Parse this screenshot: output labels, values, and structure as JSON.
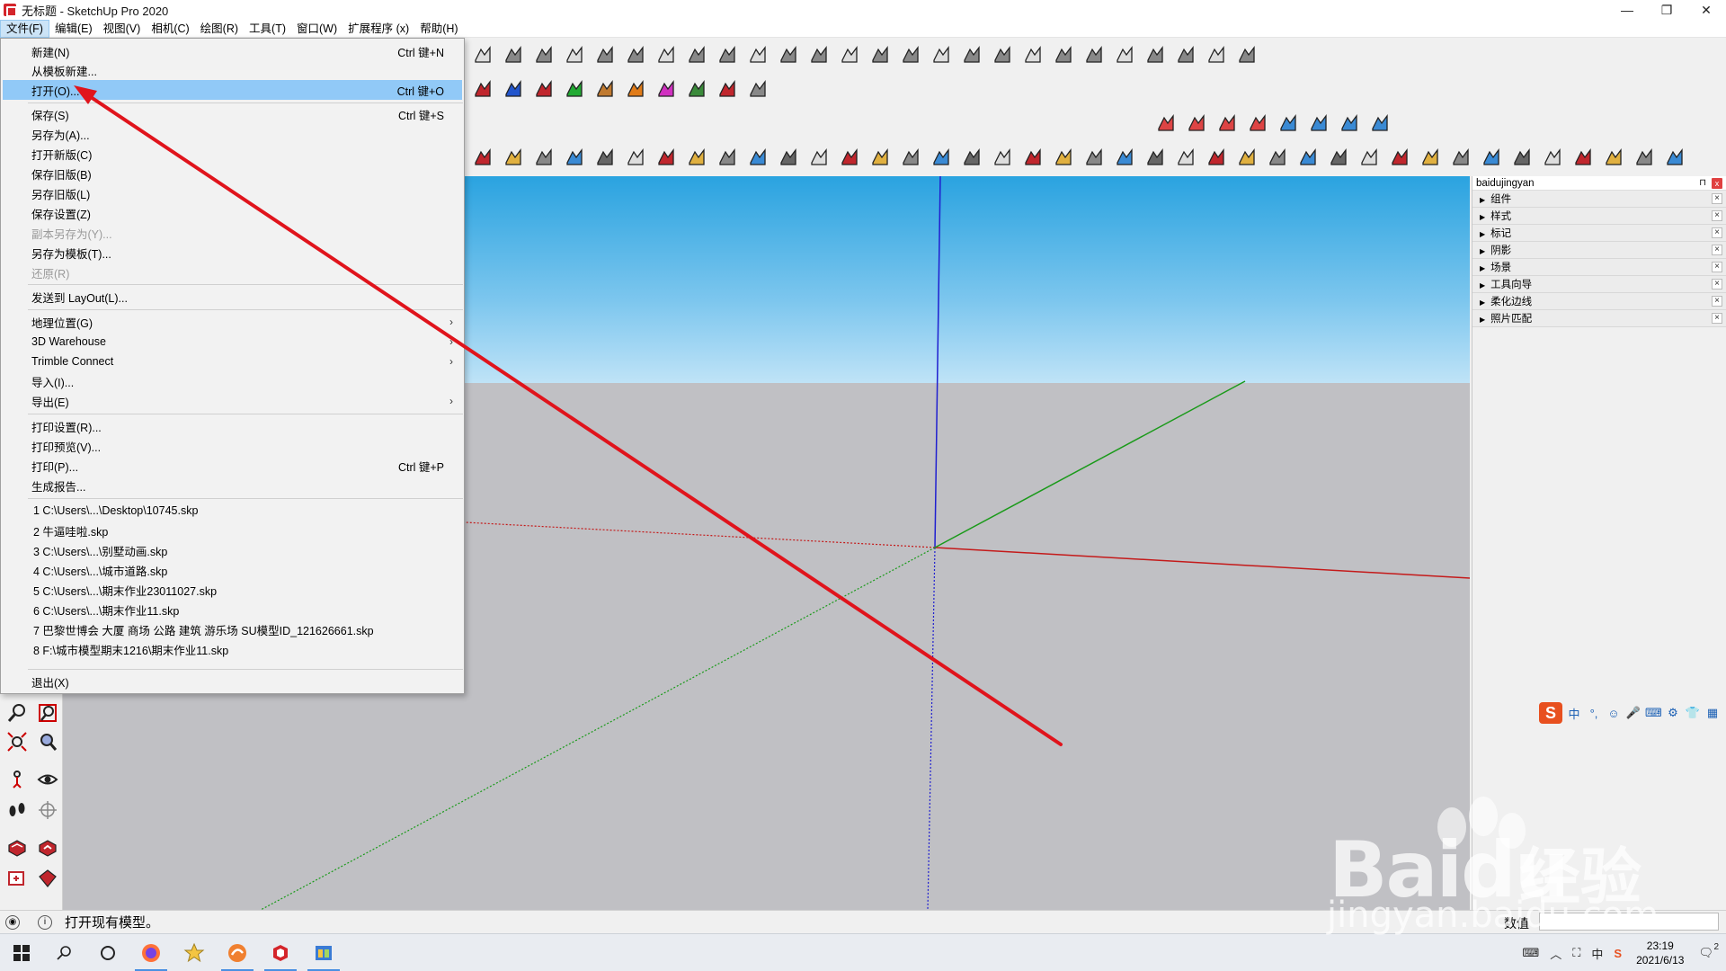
{
  "window": {
    "title": "无标题 - SketchUp Pro 2020",
    "minimize": "—",
    "restore": "❐",
    "close": "✕"
  },
  "menubar": [
    {
      "id": "file",
      "label": "文件(F)"
    },
    {
      "id": "edit",
      "label": "编辑(E)"
    },
    {
      "id": "view",
      "label": "视图(V)"
    },
    {
      "id": "camera",
      "label": "相机(C)"
    },
    {
      "id": "draw",
      "label": "绘图(R)"
    },
    {
      "id": "tools",
      "label": "工具(T)"
    },
    {
      "id": "window",
      "label": "窗口(W)"
    },
    {
      "id": "extensions",
      "label": "扩展程序 (x)"
    },
    {
      "id": "help",
      "label": "帮助(H)"
    }
  ],
  "file_menu": {
    "new": {
      "label": "新建(N)",
      "shortcut": "Ctrl 键+N"
    },
    "new_from_template": {
      "label": "从模板新建..."
    },
    "open": {
      "label": "打开(O)...",
      "shortcut": "Ctrl 键+O"
    },
    "save": {
      "label": "保存(S)",
      "shortcut": "Ctrl 键+S"
    },
    "save_as": {
      "label": "另存为(A)..."
    },
    "open_new_version": {
      "label": "打开新版(C)"
    },
    "save_old_version": {
      "label": "保存旧版(B)"
    },
    "save_as_old_version": {
      "label": "另存旧版(L)"
    },
    "save_settings": {
      "label": "保存设置(Z)"
    },
    "save_copy_as": {
      "label": "副本另存为(Y)..."
    },
    "save_as_template": {
      "label": "另存为模板(T)..."
    },
    "revert": {
      "label": "还原(R)"
    },
    "send_to_layout": {
      "label": "发送到 LayOut(L)..."
    },
    "geo_location": {
      "label": "地理位置(G)"
    },
    "warehouse": {
      "label": "3D Warehouse"
    },
    "trimble_connect": {
      "label": "Trimble Connect"
    },
    "import": {
      "label": "导入(I)..."
    },
    "export": {
      "label": "导出(E)"
    },
    "print_setup": {
      "label": "打印设置(R)..."
    },
    "print_preview": {
      "label": "打印预览(V)..."
    },
    "print": {
      "label": "打印(P)...",
      "shortcut": "Ctrl 键+P"
    },
    "generate_report": {
      "label": "生成报告..."
    },
    "recent": [
      "1 C:\\Users\\...\\Desktop\\10745.skp",
      "2 牛逼哇啦.skp",
      "3 C:\\Users\\...\\别墅动画.skp",
      "4 C:\\Users\\...\\城市道路.skp",
      "5 C:\\Users\\...\\期末作业23011027.skp",
      "6 C:\\Users\\...\\期末作业11.skp",
      "7 巴黎世博会 大厦 商场 公路 建筑 游乐场 SU模型ID_121626661.skp",
      "8 F:\\城市模型期末1216\\期末作业11.skp"
    ],
    "exit": {
      "label": "退出(X)"
    },
    "submenu_arrow": "›"
  },
  "tray": {
    "title": "baidujingyan",
    "pin": "⊓",
    "close": "x",
    "panels": [
      "组件",
      "样式",
      "标记",
      "阴影",
      "场景",
      "工具向导",
      "柔化边线",
      "照片匹配"
    ],
    "panel_arrow": "▶",
    "panel_close": "×"
  },
  "ime": {
    "logo": "S",
    "items": [
      "中",
      "°,",
      "☺",
      "🎤",
      "⌨",
      "⚙",
      "👕",
      "▦"
    ]
  },
  "status": {
    "info_icon": "i",
    "text": "打开现有模型。",
    "measure_label": "数值"
  },
  "taskbar": {
    "time": "23:19",
    "date": "2021/6/13",
    "ime_lang": "中",
    "notification_count": "2"
  },
  "watermark": {
    "brand": "Bai",
    "brand2": "du",
    "cn": "经验",
    "url": "jingyan.baidu.com"
  },
  "colors": {
    "accent_hover": "#91c9f7",
    "axis_red": "#cc0000",
    "axis_green": "#1a9a1a",
    "axis_blue": "#1a1acc",
    "annotation": "#e0141c"
  }
}
